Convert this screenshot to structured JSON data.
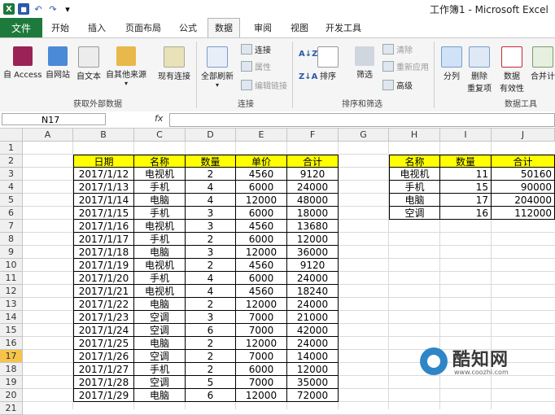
{
  "window": {
    "title": "工作簿1 - Microsoft Excel"
  },
  "tabs": [
    "文件",
    "开始",
    "插入",
    "页面布局",
    "公式",
    "数据",
    "审阅",
    "视图",
    "开发工具"
  ],
  "active_tab": "数据",
  "ribbon": {
    "external": {
      "access": "自 Access",
      "web": "自网站",
      "text": "自文本",
      "other": "自其他来源",
      "existing": "现有连接",
      "group_label": "获取外部数据"
    },
    "connections": {
      "refresh_all": "全部刷新",
      "connect": "连接",
      "properties": "属性",
      "edit_links": "编辑链接",
      "group_label": "连接"
    },
    "sort_filter": {
      "sort_az": "A↓Z",
      "sort_za": "Z↓A",
      "sort": "排序",
      "filter": "筛选",
      "clear": "清除",
      "reapply": "重新应用",
      "advanced": "高级",
      "group_label": "排序和筛选"
    },
    "tools": {
      "split": "分列",
      "remove_dup_1": "删除",
      "remove_dup_2": "重复项",
      "validate_1": "数据",
      "validate_2": "有效性",
      "consolidate": "合并计",
      "group_label": "数据工具"
    }
  },
  "formula_bar": {
    "name_box": "N17",
    "fx": "fx",
    "formula": ""
  },
  "columns": [
    "A",
    "B",
    "C",
    "D",
    "E",
    "F",
    "G",
    "H",
    "I",
    "J"
  ],
  "rows": [
    "1",
    "2",
    "3",
    "4",
    "5",
    "6",
    "7",
    "8",
    "9",
    "10",
    "11",
    "12",
    "13",
    "14",
    "15",
    "16",
    "17",
    "18",
    "19",
    "20",
    "21"
  ],
  "selected_row": "17",
  "main_table": {
    "headers": [
      "日期",
      "名称",
      "数量",
      "单价",
      "合计"
    ],
    "rows": [
      [
        "2017/1/12",
        "电视机",
        "2",
        "4560",
        "9120"
      ],
      [
        "2017/1/13",
        "手机",
        "4",
        "6000",
        "24000"
      ],
      [
        "2017/1/14",
        "电脑",
        "4",
        "12000",
        "48000"
      ],
      [
        "2017/1/15",
        "手机",
        "3",
        "6000",
        "18000"
      ],
      [
        "2017/1/16",
        "电视机",
        "3",
        "4560",
        "13680"
      ],
      [
        "2017/1/17",
        "手机",
        "2",
        "6000",
        "12000"
      ],
      [
        "2017/1/18",
        "电脑",
        "3",
        "12000",
        "36000"
      ],
      [
        "2017/1/19",
        "电视机",
        "2",
        "4560",
        "9120"
      ],
      [
        "2017/1/20",
        "手机",
        "4",
        "6000",
        "24000"
      ],
      [
        "2017/1/21",
        "电视机",
        "4",
        "4560",
        "18240"
      ],
      [
        "2017/1/22",
        "电脑",
        "2",
        "12000",
        "24000"
      ],
      [
        "2017/1/23",
        "空调",
        "3",
        "7000",
        "21000"
      ],
      [
        "2017/1/24",
        "空调",
        "6",
        "7000",
        "42000"
      ],
      [
        "2017/1/25",
        "电脑",
        "2",
        "12000",
        "24000"
      ],
      [
        "2017/1/26",
        "空调",
        "2",
        "7000",
        "14000"
      ],
      [
        "2017/1/27",
        "手机",
        "2",
        "6000",
        "12000"
      ],
      [
        "2017/1/28",
        "空调",
        "5",
        "7000",
        "35000"
      ],
      [
        "2017/1/29",
        "电脑",
        "6",
        "12000",
        "72000"
      ]
    ]
  },
  "summary_table": {
    "headers": [
      "名称",
      "数量",
      "合计"
    ],
    "rows": [
      [
        "电视机",
        "11",
        "50160"
      ],
      [
        "手机",
        "15",
        "90000"
      ],
      [
        "电脑",
        "17",
        "204000"
      ],
      [
        "空调",
        "16",
        "112000"
      ]
    ]
  },
  "watermark": {
    "text": "酷知网",
    "url": "www.coozhi.com"
  },
  "colors": {
    "header_fill": "#ffff00",
    "file_tab": "#1e7a3c",
    "selected_row_header": "#f7c44a"
  }
}
